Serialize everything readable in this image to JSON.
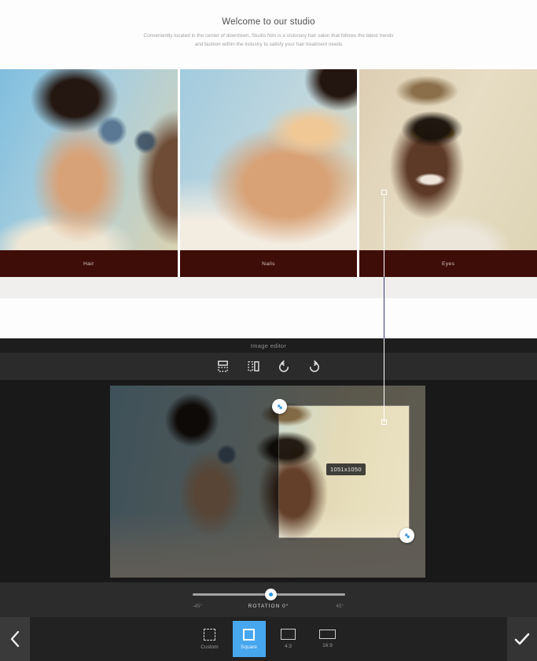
{
  "site": {
    "hero": {
      "title": "Welcome to our studio",
      "subtitle": "Conveniently located in the center of downtown, Studio Nim is a visionary hair salon that follows the latest trends and fashion within the industry to satisfy your hair treatment needs"
    },
    "gallery": {
      "items": [
        {
          "label": "Hair"
        },
        {
          "label": "Nails"
        },
        {
          "label": "Eyes"
        }
      ],
      "label_bar_color": "#3f0d08"
    }
  },
  "editor": {
    "title": "Image editor",
    "toolbar": {
      "icons": [
        "flip-vertical-icon",
        "flip-horizontal-icon",
        "rotate-counterclockwise-icon",
        "rotate-clockwise-icon"
      ]
    },
    "crop": {
      "size_label": "1051x1050"
    },
    "rotation": {
      "min_label": "-45°",
      "value_label": "ROTATION 0°",
      "max_label": "45°",
      "value_degrees": 0
    },
    "ratios": {
      "selected": "Square",
      "options": [
        {
          "label": "Custom"
        },
        {
          "label": "Square"
        },
        {
          "label": "4:3"
        },
        {
          "label": "16:9"
        }
      ]
    },
    "colors": {
      "accent_blue": "#47a7ee",
      "panel_dark": "#222222"
    }
  }
}
